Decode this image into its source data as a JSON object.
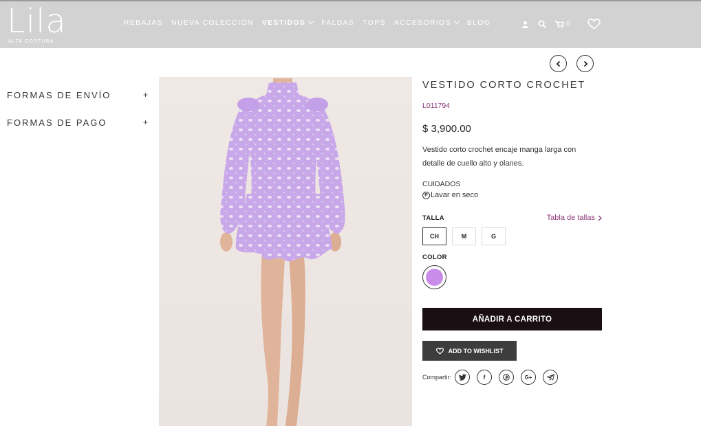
{
  "brand": {
    "name": "Lila",
    "tagline": "ALTA COSTURA"
  },
  "nav": [
    {
      "label": "REBAJAS",
      "active": false,
      "dropdown": false
    },
    {
      "label": "NUEVA COLECCIÓN",
      "active": false,
      "dropdown": false
    },
    {
      "label": "VESTIDOS",
      "active": true,
      "dropdown": true
    },
    {
      "label": "FALDAS",
      "active": false,
      "dropdown": false
    },
    {
      "label": "TOPS",
      "active": false,
      "dropdown": false
    },
    {
      "label": "ACCESORIOS",
      "active": false,
      "dropdown": true
    },
    {
      "label": "BLOG",
      "active": false,
      "dropdown": false
    }
  ],
  "header_icons": {
    "account": "user-icon",
    "search": "search-icon",
    "cart": "cart-icon",
    "cart_count": "0",
    "wishlist": "heart-icon"
  },
  "pager": {
    "prev": "chevron-left-icon",
    "next": "chevron-right-icon"
  },
  "sidebar": {
    "items": [
      {
        "label": "FORMAS DE ENVÍO",
        "toggle": "+"
      },
      {
        "label": "FORMAS DE PAGO",
        "toggle": "+"
      }
    ]
  },
  "product": {
    "title": "VESTIDO CORTO CROCHET",
    "sku": "L011794",
    "price": "$ 3,900.00",
    "description": "Vestido corto crochet encaje manga larga con detalle de cuello alto y olanes.",
    "care_heading": "CUIDADOS",
    "care_item": "Lavar en seco",
    "care_icon_letter": "P",
    "size_label": "TALLA",
    "size_table_link": "Tabla de tallas",
    "sizes": [
      "CH",
      "M",
      "G"
    ],
    "selected_size": "CH",
    "color_label": "COLOR",
    "colors": [
      "#c98ce9"
    ],
    "add_to_cart": "AÑADIR A CARRITO",
    "add_to_wishlist": "ADD TO WISHLIST",
    "share_label": "Compartir:",
    "share_icons": [
      "twitter-icon",
      "facebook-icon",
      "pinterest-icon",
      "google-plus-icon",
      "telegram-icon"
    ]
  },
  "colors": {
    "header_bg": "#d2d2d2",
    "accent": "#8e3a7a",
    "button_dark": "#1a0f12",
    "dress": "#c9a8ea"
  }
}
